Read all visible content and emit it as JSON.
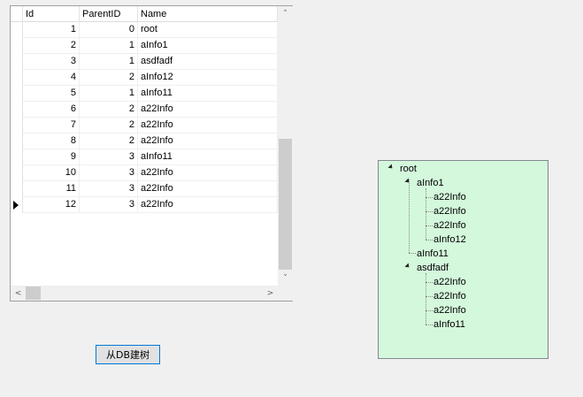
{
  "grid": {
    "columns": {
      "id": "Id",
      "parent_id": "ParentID",
      "name": "Name"
    },
    "rows": [
      {
        "id": "1",
        "parent_id": "0",
        "name": "root"
      },
      {
        "id": "2",
        "parent_id": "1",
        "name": "aInfo1"
      },
      {
        "id": "3",
        "parent_id": "1",
        "name": "asdfadf"
      },
      {
        "id": "4",
        "parent_id": "2",
        "name": "aInfo12"
      },
      {
        "id": "5",
        "parent_id": "1",
        "name": "aInfo11"
      },
      {
        "id": "6",
        "parent_id": "2",
        "name": "a22Info"
      },
      {
        "id": "7",
        "parent_id": "2",
        "name": "a22Info"
      },
      {
        "id": "8",
        "parent_id": "2",
        "name": "a22Info"
      },
      {
        "id": "9",
        "parent_id": "3",
        "name": "aInfo11"
      },
      {
        "id": "10",
        "parent_id": "3",
        "name": "a22Info"
      },
      {
        "id": "11",
        "parent_id": "3",
        "name": "a22Info"
      },
      {
        "id": "12",
        "parent_id": "3",
        "name": "a22Info"
      }
    ],
    "current_row": 12
  },
  "button": {
    "label": "从DB建树"
  },
  "tree": {
    "root": "root",
    "node_ainfo1": "aInfo1",
    "ainfo1_children": [
      "a22Info",
      "a22Info",
      "a22Info",
      "aInfo12"
    ],
    "node_ainfo11": "aInfo11",
    "node_asdfadf": "asdfadf",
    "asdfadf_children": [
      "a22Info",
      "a22Info",
      "a22Info",
      "aInfo11"
    ]
  },
  "colors": {
    "tree_background": "#d4f8dc",
    "button_border": "#0078d7",
    "window_background": "#f0f0f0"
  }
}
